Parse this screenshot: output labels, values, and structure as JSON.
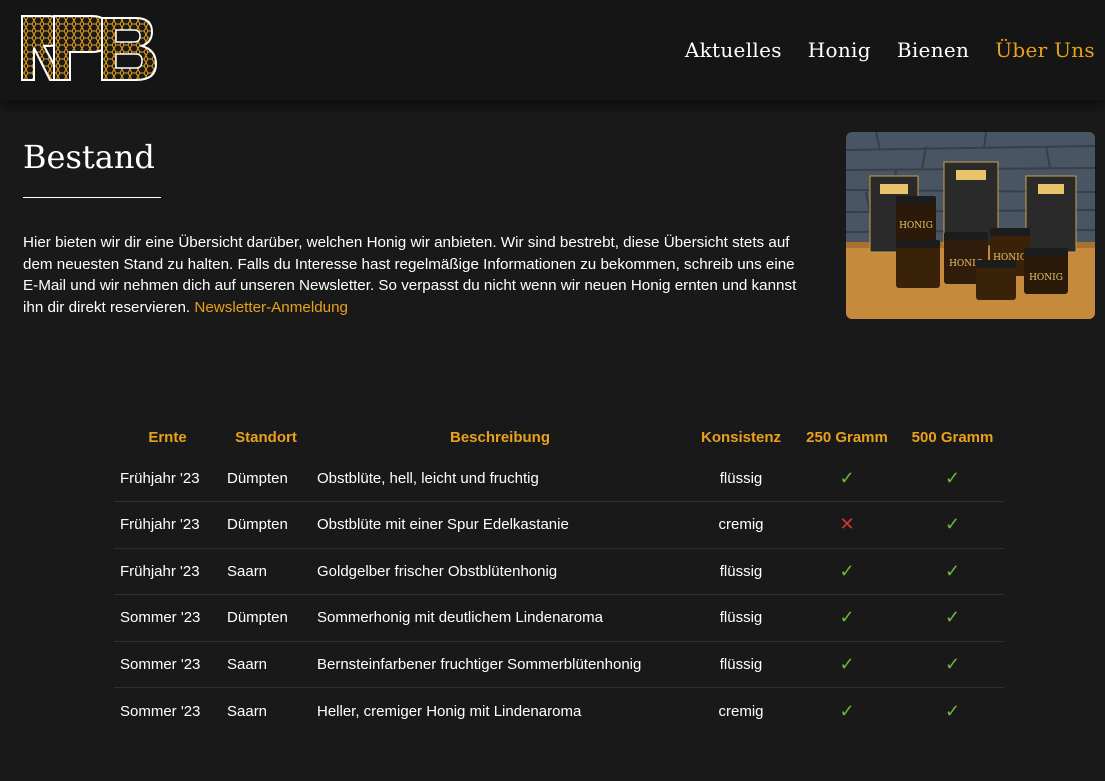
{
  "header": {
    "logo_text": "RPB",
    "nav": [
      {
        "label": "Aktuelles",
        "active": false
      },
      {
        "label": "Honig",
        "active": false
      },
      {
        "label": "Bienen",
        "active": false
      },
      {
        "label": "Über Uns",
        "active": true
      }
    ]
  },
  "main": {
    "title": "Bestand",
    "intro": "Hier bieten wir dir eine Übersicht darüber, welchen Honig wir anbieten. Wir sind bestrebt, diese Übersicht stets auf dem neuesten Stand zu halten. Falls du Interesse hast regelmäßige Informationen zu bekommen, schreib uns eine E-Mail und wir nehmen dich auf unseren Newsletter. So verpasst du nicht wenn wir neuen Honig ernten und kannst ihn dir direkt reservieren.",
    "newsletter_link": "Newsletter-Anmeldung",
    "photo_labels": [
      "HONIG",
      "HONIG",
      "HONIG",
      "HONIG"
    ]
  },
  "table": {
    "headers": [
      "Ernte",
      "Standort",
      "Beschreibung",
      "Konsistenz",
      "250 Gramm",
      "500 Gramm"
    ],
    "rows": [
      {
        "ernte": "Frühjahr '23",
        "standort": "Dümpten",
        "beschreibung": "Obstblüte, hell, leicht und fruchtig",
        "konsistenz": "flüssig",
        "g250": true,
        "g500": true
      },
      {
        "ernte": "Frühjahr '23",
        "standort": "Dümpten",
        "beschreibung": "Obstblüte mit einer Spur Edelkastanie",
        "konsistenz": "cremig",
        "g250": false,
        "g500": true
      },
      {
        "ernte": "Frühjahr '23",
        "standort": "Saarn",
        "beschreibung": "Goldgelber frischer Obstblütenhonig",
        "konsistenz": "flüssig",
        "g250": true,
        "g500": true
      },
      {
        "ernte": "Sommer '23",
        "standort": "Dümpten",
        "beschreibung": "Sommerhonig mit deutlichem Lindenaroma",
        "konsistenz": "flüssig",
        "g250": true,
        "g500": true
      },
      {
        "ernte": "Sommer '23",
        "standort": "Saarn",
        "beschreibung": "Bernsteinfarbener fruchtiger Sommerblütenhonig",
        "konsistenz": "flüssig",
        "g250": true,
        "g500": true
      },
      {
        "ernte": "Sommer '23",
        "standort": "Saarn",
        "beschreibung": "Heller, cremiger Honig mit Lindenaroma",
        "konsistenz": "cremig",
        "g250": true,
        "g500": true
      }
    ],
    "available_glyph": "✓",
    "unavailable_glyph": "✕"
  },
  "colors": {
    "background": "#191919",
    "header": "#151515",
    "accent": "#e8a11a",
    "available": "#69b83a",
    "unavailable": "#d63333"
  },
  "icons": {
    "available": "checkmark-icon",
    "unavailable": "cross-icon"
  }
}
